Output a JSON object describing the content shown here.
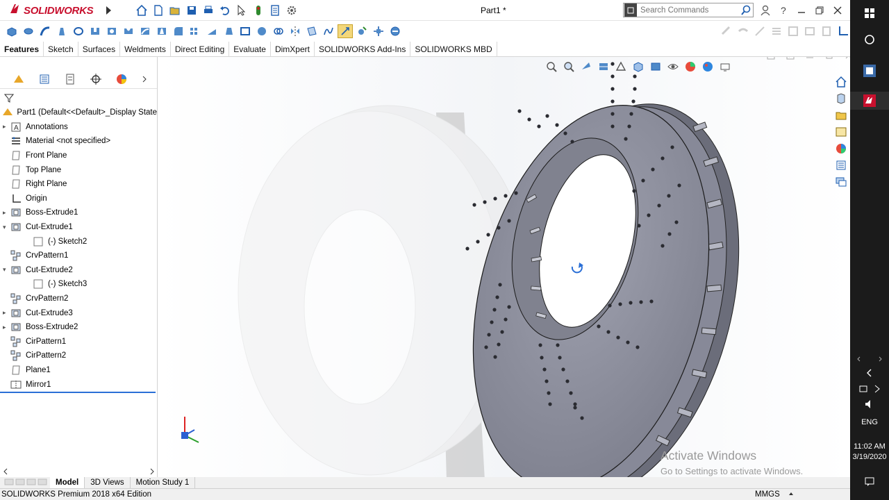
{
  "app": {
    "brand": "SOLIDWORKS",
    "document_title": "Part1 *",
    "search_placeholder": "Search Commands",
    "edition": "SOLIDWORKS Premium 2018 x64 Edition",
    "units": "MMGS"
  },
  "command_tabs": [
    "Features",
    "Sketch",
    "Surfaces",
    "Weldments",
    "Direct Editing",
    "Evaluate",
    "DimXpert",
    "SOLIDWORKS Add-Ins",
    "SOLIDWORKS MBD"
  ],
  "active_command_tab": "Features",
  "feature_tree": {
    "root_label": "Part1  (Default<<Default>_Display State",
    "items": [
      {
        "label": "Annotations",
        "expander": "▸",
        "icon": "annotations-icon"
      },
      {
        "label": "Material <not specified>",
        "expander": "",
        "icon": "material-icon"
      },
      {
        "label": "Front Plane",
        "expander": "",
        "icon": "plane-icon"
      },
      {
        "label": "Top Plane",
        "expander": "",
        "icon": "plane-icon"
      },
      {
        "label": "Right Plane",
        "expander": "",
        "icon": "plane-icon"
      },
      {
        "label": "Origin",
        "expander": "",
        "icon": "origin-icon"
      },
      {
        "label": "Boss-Extrude1",
        "expander": "▸",
        "icon": "extrude-icon"
      },
      {
        "label": "Cut-Extrude1",
        "expander": "▾",
        "icon": "extrude-icon"
      },
      {
        "label": "(-) Sketch2",
        "expander": "",
        "icon": "sketch-icon",
        "indent": true
      },
      {
        "label": "CrvPattern1",
        "expander": "",
        "icon": "pattern-icon"
      },
      {
        "label": "Cut-Extrude2",
        "expander": "▾",
        "icon": "extrude-icon"
      },
      {
        "label": "(-) Sketch3",
        "expander": "",
        "icon": "sketch-icon",
        "indent": true
      },
      {
        "label": "CrvPattern2",
        "expander": "",
        "icon": "pattern-icon"
      },
      {
        "label": "Cut-Extrude3",
        "expander": "▸",
        "icon": "extrude-icon"
      },
      {
        "label": "Boss-Extrude2",
        "expander": "▸",
        "icon": "extrude-icon"
      },
      {
        "label": "CirPattern1",
        "expander": "",
        "icon": "pattern-icon"
      },
      {
        "label": "CirPattern2",
        "expander": "",
        "icon": "pattern-icon"
      },
      {
        "label": "Plane1",
        "expander": "",
        "icon": "plane-icon"
      },
      {
        "label": "Mirror1",
        "expander": "",
        "icon": "mirror-icon"
      }
    ]
  },
  "bottom_tabs": [
    "Model",
    "3D Views",
    "Motion Study 1"
  ],
  "active_bottom_tab": "Model",
  "watermark": {
    "line1": "Activate Windows",
    "line2": "Go to Settings to activate Windows."
  },
  "system_tray": {
    "language": "ENG",
    "time": "11:02 AM",
    "date": "3/19/2020"
  },
  "colors": {
    "brand_red": "#c8102e",
    "selection_blue": "#2a6fd6",
    "part_gray": "#8c8e9c",
    "taskbar": "#1b1b1b"
  }
}
